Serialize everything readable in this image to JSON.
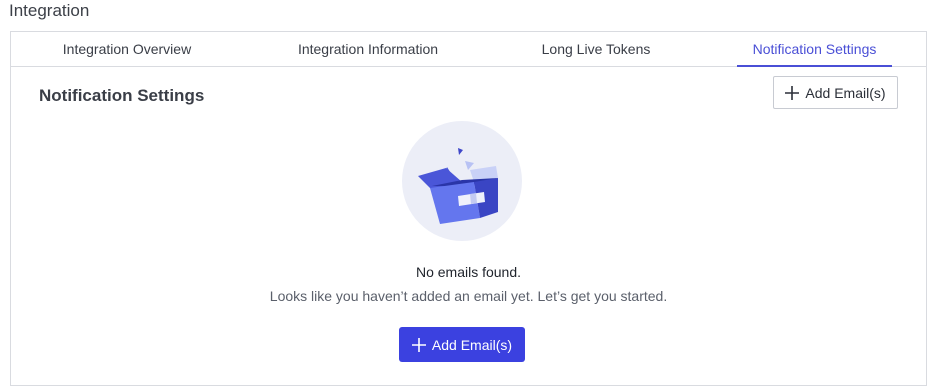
{
  "page": {
    "title": "Integration"
  },
  "tabs": [
    {
      "label": "Integration Overview",
      "active": false
    },
    {
      "label": "Integration Information",
      "active": false
    },
    {
      "label": "Long Live Tokens",
      "active": false
    },
    {
      "label": "Notification Settings",
      "active": true
    }
  ],
  "section": {
    "title": "Notification Settings",
    "add_button_label": "Add Email(s)"
  },
  "empty_state": {
    "icon": "empty-box-illustration",
    "title": "No emails found.",
    "message": "Looks like you haven’t added an email yet. Let’s get you started.",
    "button_label": "Add Email(s)"
  },
  "colors": {
    "accent": "#3b41e0",
    "active_tab": "#4a4fd6",
    "border": "#d9dbe0"
  }
}
